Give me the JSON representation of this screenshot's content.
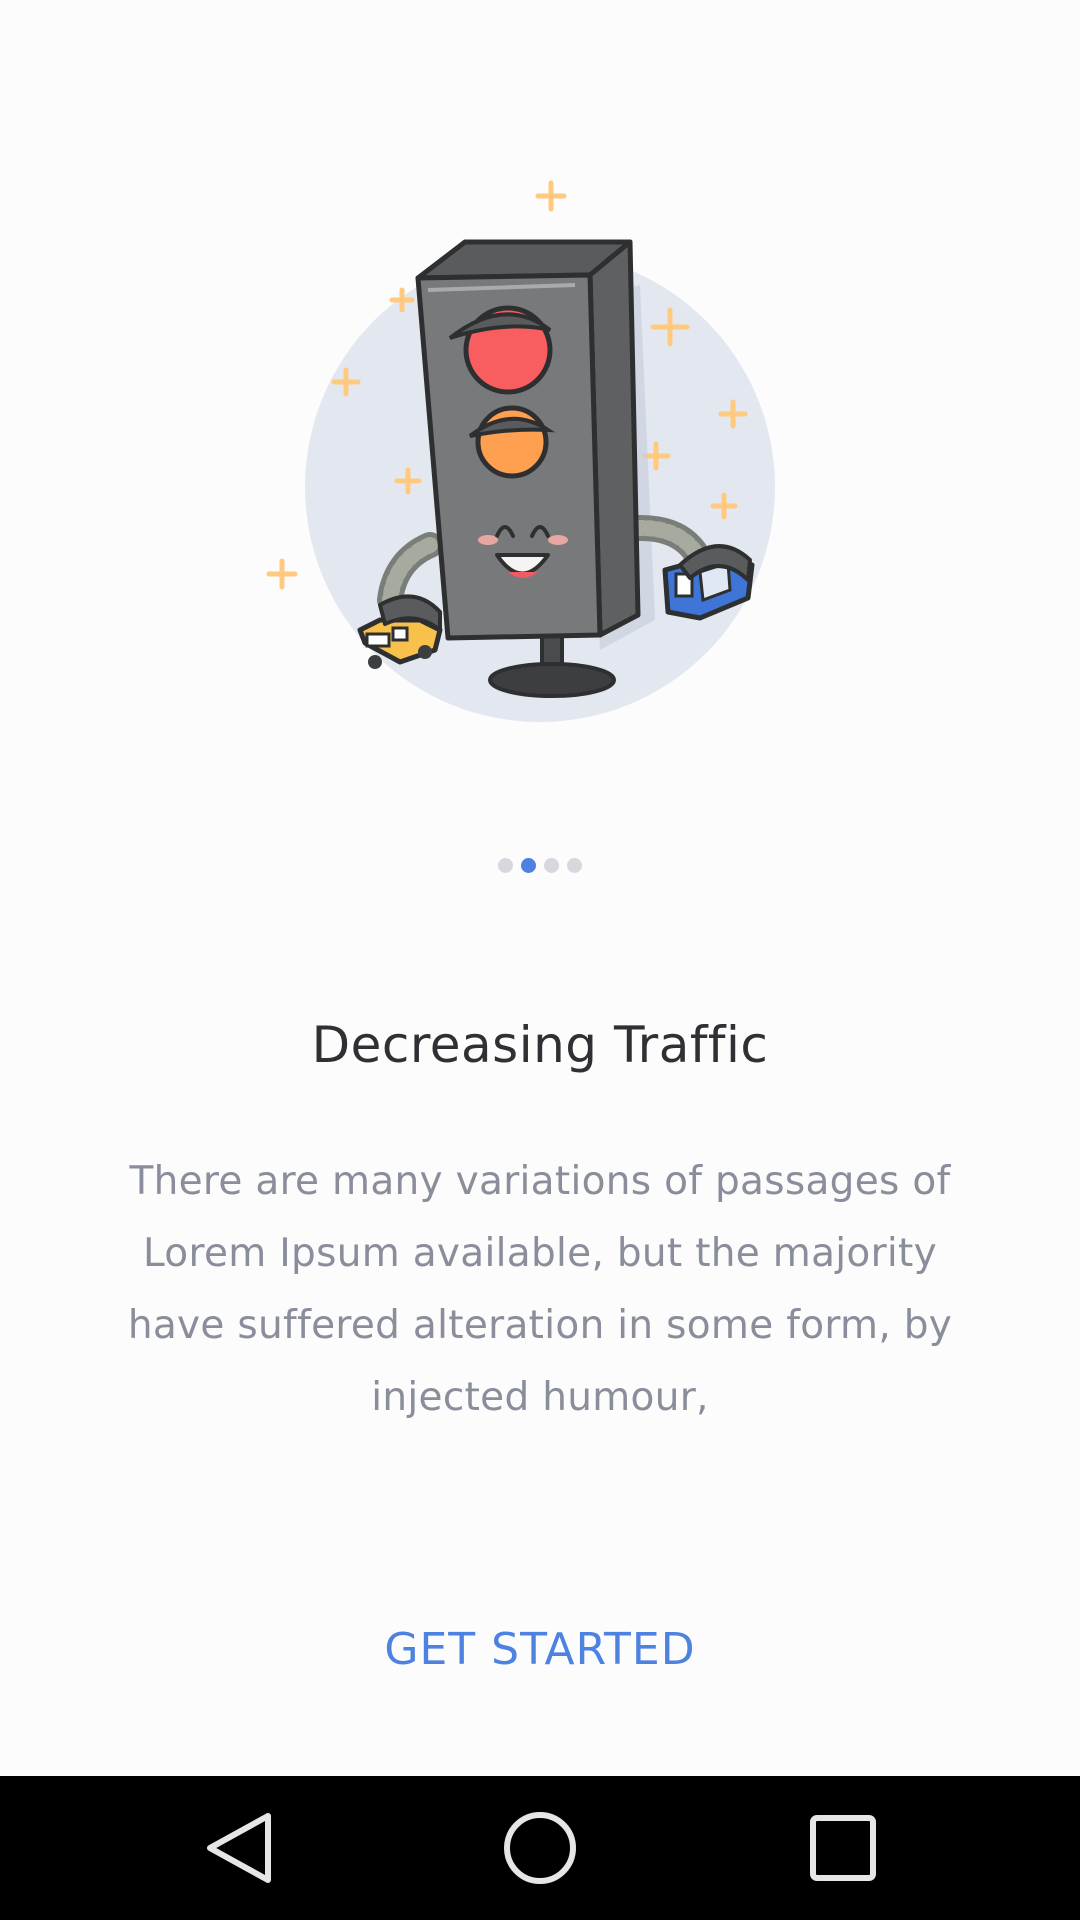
{
  "onboarding": {
    "title": "Decreasing Traffic",
    "description": "There are many variations of passages of Lorem Ipsum available, but the majority have suffered alteration in some form, by injected humour,",
    "cta_label": "GET STARTED",
    "page_count": 4,
    "active_page": 2
  },
  "illustration": {
    "subject": "traffic-light-mascot",
    "colors": {
      "background_circle": "#e3e8f0",
      "sparkle": "#ffc97e",
      "light_red": "#f85e5f",
      "light_orange": "#ffa050",
      "body": "#78797b",
      "car_yellow": "#f7c14b",
      "car_blue": "#3e75d6"
    }
  },
  "colors": {
    "accent": "#4d82e0",
    "title": "#2f3034",
    "body_text": "#8a8e9b",
    "dot_inactive": "#d6d8dd"
  },
  "system_nav": {
    "back_icon": "back-triangle-icon",
    "home_icon": "home-circle-icon",
    "recents_icon": "recents-square-icon"
  }
}
